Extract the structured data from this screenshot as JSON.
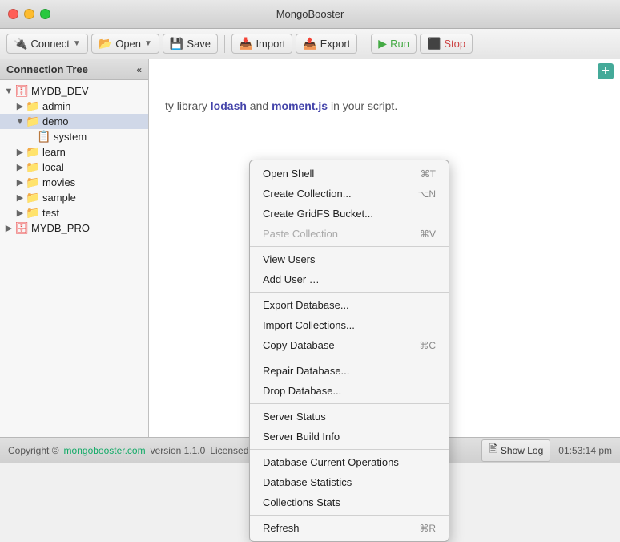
{
  "window": {
    "title": "MongoBooster"
  },
  "traffic_lights": {
    "close": "close",
    "minimize": "minimize",
    "maximize": "maximize"
  },
  "toolbar": {
    "connect_label": "Connect",
    "open_label": "Open",
    "save_label": "Save",
    "import_label": "Import",
    "export_label": "Export",
    "run_label": "Run",
    "stop_label": "Stop"
  },
  "sidebar": {
    "title": "Connection Tree",
    "collapse_icon": "«",
    "add_icon": "+",
    "tree": [
      {
        "id": "mydb_dev",
        "label": "MYDB_DEV",
        "indent": 0,
        "type": "db",
        "expanded": true
      },
      {
        "id": "admin",
        "label": "admin",
        "indent": 1,
        "type": "folder"
      },
      {
        "id": "demo",
        "label": "demo",
        "indent": 1,
        "type": "folder",
        "selected": true
      },
      {
        "id": "system",
        "label": "system",
        "indent": 2,
        "type": "collection"
      },
      {
        "id": "learn",
        "label": "learn",
        "indent": 1,
        "type": "folder"
      },
      {
        "id": "local",
        "label": "local",
        "indent": 1,
        "type": "folder"
      },
      {
        "id": "movies",
        "label": "movies",
        "indent": 1,
        "type": "folder"
      },
      {
        "id": "sample",
        "label": "sample",
        "indent": 1,
        "type": "folder"
      },
      {
        "id": "test",
        "label": "test",
        "indent": 1,
        "type": "folder"
      },
      {
        "id": "mydb_pro",
        "label": "MYDB_PRO",
        "indent": 0,
        "type": "db"
      }
    ]
  },
  "context_menu": {
    "items": [
      {
        "id": "open-shell",
        "label": "Open Shell",
        "shortcut": "⌘T",
        "group": 1
      },
      {
        "id": "create-collection",
        "label": "Create Collection...",
        "shortcut": "⌥N",
        "group": 1
      },
      {
        "id": "create-gridfs-bucket",
        "label": "Create GridFS Bucket...",
        "shortcut": "",
        "group": 1
      },
      {
        "id": "paste-collection",
        "label": "Paste Collection",
        "shortcut": "⌘V",
        "disabled": true,
        "group": 1
      },
      {
        "id": "view-users",
        "label": "View Users",
        "shortcut": "",
        "group": 2
      },
      {
        "id": "add-user",
        "label": "Add User …",
        "shortcut": "",
        "group": 2
      },
      {
        "id": "export-database",
        "label": "Export Database...",
        "shortcut": "",
        "group": 3
      },
      {
        "id": "import-collections",
        "label": "Import Collections...",
        "shortcut": "",
        "group": 3
      },
      {
        "id": "copy-database",
        "label": "Copy Database",
        "shortcut": "⌘C",
        "group": 3
      },
      {
        "id": "repair-database",
        "label": "Repair Database...",
        "shortcut": "",
        "group": 4
      },
      {
        "id": "drop-database",
        "label": "Drop Database...",
        "shortcut": "",
        "group": 4
      },
      {
        "id": "server-status",
        "label": "Server Status",
        "shortcut": "",
        "group": 5
      },
      {
        "id": "server-build-info",
        "label": "Server Build Info",
        "shortcut": "",
        "group": 5
      },
      {
        "id": "db-current-ops",
        "label": "Database Current Operations",
        "shortcut": "",
        "group": 6
      },
      {
        "id": "db-statistics",
        "label": "Database Statistics",
        "shortcut": "",
        "group": 6
      },
      {
        "id": "collections-stats",
        "label": "Collections Stats",
        "shortcut": "",
        "group": 6
      },
      {
        "id": "refresh",
        "label": "Refresh",
        "shortcut": "⌘R",
        "group": 7
      }
    ]
  },
  "content": {
    "text_before": "ty library ",
    "link1": "lodash",
    "text_middle": " and ",
    "link2": "moment.js",
    "text_after": " in your script."
  },
  "statusbar": {
    "copyright": "Copyright ©",
    "website": "mongobooster.com",
    "version": "version 1.1.0",
    "license": "Licensed to qinghai",
    "show_log": "Show Log",
    "time": "01:53:14 pm"
  }
}
